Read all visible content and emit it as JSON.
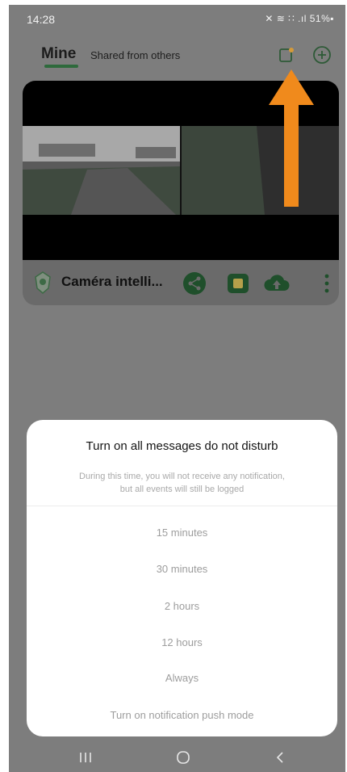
{
  "status_bar": {
    "time": "14:28",
    "indicators": "✕ ≋ ∷ .ıl 51%▪",
    "battery_percent": "51%"
  },
  "tabs": {
    "mine": "Mine",
    "shared": "Shared from others"
  },
  "header_icons": [
    "message-notification-icon",
    "add-circle-icon"
  ],
  "camera_card": {
    "name": "Caméra intelli...",
    "actions": [
      "share-icon",
      "clip-icon",
      "cloud-upload-icon",
      "more-vertical-icon"
    ]
  },
  "dnd_sheet": {
    "title": "Turn on all messages do not disturb",
    "description_line1": "During this time, you will not receive any notification,",
    "description_line2": "but all events will still be logged",
    "options": [
      "15 minutes",
      "30 minutes",
      "2 hours",
      "12 hours",
      "Always",
      "Turn on notification push mode"
    ]
  },
  "nav_bar": [
    "recent-apps-icon",
    "home-icon",
    "back-icon"
  ],
  "colors": {
    "overlay_gray": "#7d7d7d",
    "accent_green": "#2e6a3c",
    "annotation_arrow": "#f08a1c",
    "sheet_bg": "#ffffff",
    "option_text": "#9d9d9d"
  }
}
